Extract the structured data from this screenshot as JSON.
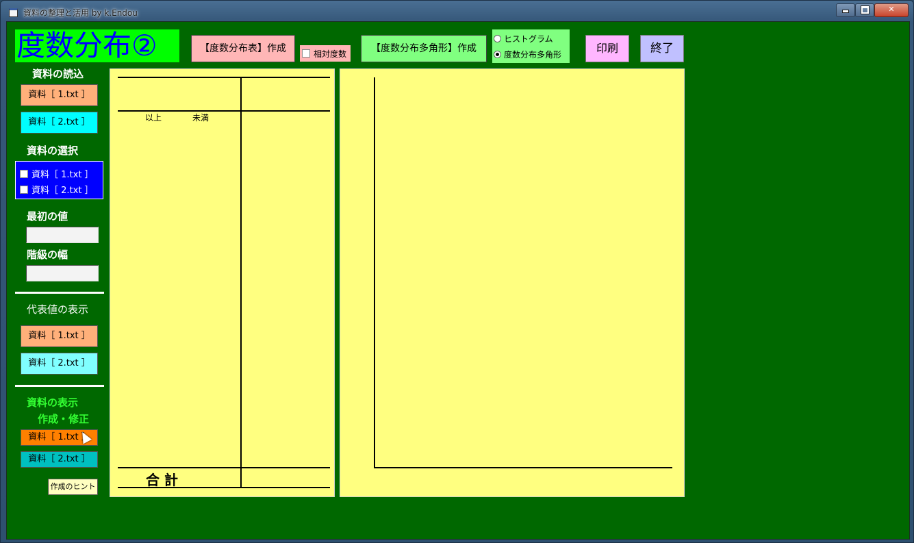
{
  "window": {
    "title": "資料の整理と活用  by k.Endou"
  },
  "header": {
    "app_title": "度数分布②",
    "make_table_button": "【度数分布表】作成",
    "relative_freq_label": "相対度数",
    "make_polygon_button": "【度数分布多角形】作成",
    "graph_types": [
      {
        "label": "ヒストグラム",
        "selected": false
      },
      {
        "label": "度数分布多角形",
        "selected": true
      }
    ],
    "print_button": "印刷",
    "exit_button": "終了"
  },
  "sidebar": {
    "load_heading": "資料の読込",
    "load_buttons": [
      "資料［ 1.txt ］",
      "資料［ 2.txt ］"
    ],
    "select_heading": "資料の選択",
    "select_options": [
      "資料［ 1.txt ］",
      "資料［ 2.txt ］"
    ],
    "first_value_label": "最初の値",
    "first_value": "",
    "class_width_label": "階級の幅",
    "class_width": "",
    "representative_heading": "代表値の表示",
    "representative_buttons": [
      "資料［ 1.txt ］",
      "資料［ 2.txt ］"
    ],
    "display_heading_line1": "資料の表示",
    "display_heading_line2": "作成・修正",
    "display_buttons": [
      "資料［ 1.txt ］",
      "資料［ 2.txt ］"
    ],
    "hint_button": "作成のヒント"
  },
  "table": {
    "lower_label": "以上",
    "upper_label": "未満",
    "total_label": "合 計"
  },
  "colors": {
    "client_bg": "#006800",
    "panel_bg": "#ffff80",
    "title_bg": "#00ff00",
    "title_fg": "#0000ff"
  }
}
